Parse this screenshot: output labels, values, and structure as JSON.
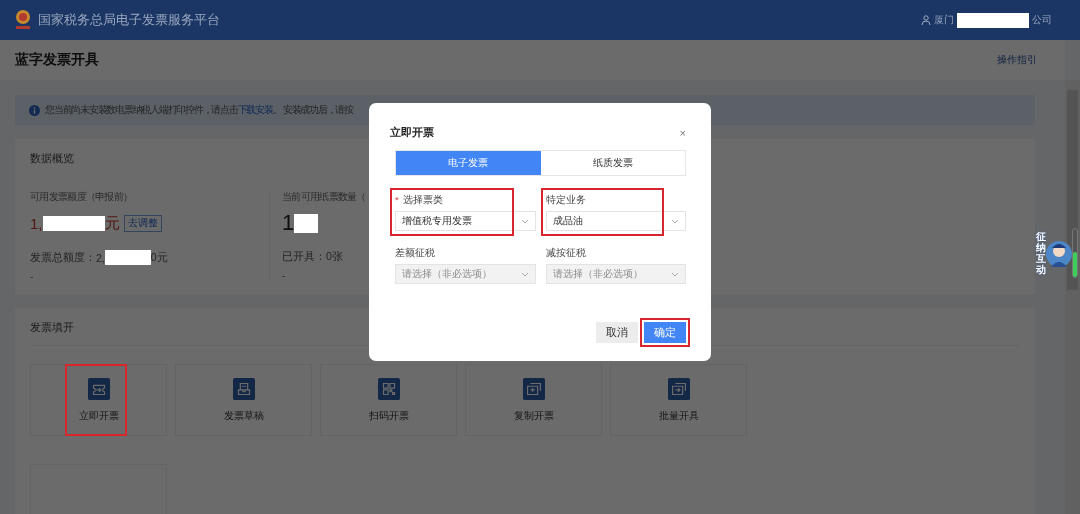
{
  "header": {
    "title": "国家税务总局电子发票服务平台",
    "user_prefix": "厦门",
    "user_suffix": "公司"
  },
  "page": {
    "title": "蓝字发票开具",
    "guide_link": "操作指引"
  },
  "notice": {
    "text_before": "您当前尚未安装数电票纳税人端打印控件，请点击",
    "link": "下载安装",
    "text_after": "。 安装成功后，请按"
  },
  "overview": {
    "title": "数据概览",
    "stats": [
      {
        "kind": "amount",
        "label": "可用发票额度（申报前）",
        "value_prefix": "1,",
        "value_suffix": "元",
        "tag": "去调整",
        "note_label": "发票总额度：",
        "note_prefix": "2,",
        "note_suffix": "0元",
        "footer": "-"
      },
      {
        "kind": "count",
        "label": "当前可用纸票数量（",
        "value_prefix": "1",
        "note_label": "已开具：",
        "note_suffix": "0张",
        "footer": "-"
      }
    ]
  },
  "issue": {
    "title": "发票填开",
    "tiles": [
      {
        "kind": "issue",
        "label": "立即开票",
        "highlighted": true
      },
      {
        "kind": "draft",
        "label": "发票草稿",
        "highlighted": false
      },
      {
        "kind": "scan",
        "label": "扫码开票",
        "highlighted": false
      },
      {
        "kind": "copy",
        "label": "复制开票",
        "highlighted": false
      },
      {
        "kind": "batch",
        "label": "批量开具",
        "highlighted": false
      }
    ]
  },
  "dialog": {
    "title": "立即开票",
    "close": "×",
    "tabs": [
      {
        "label": "电子发票",
        "selected": true
      },
      {
        "label": "纸质发票",
        "selected": false
      }
    ],
    "fields": [
      {
        "label": "选择票类",
        "required_mark": "*",
        "value": "增值税专用发票",
        "disabled": false,
        "highlighted": true
      },
      {
        "label": "特定业务",
        "value": "成品油",
        "disabled": false,
        "highlighted": true
      },
      {
        "label": "差额征税",
        "placeholder": "请选择（非必选项）",
        "disabled": true,
        "highlighted": false
      },
      {
        "label": "减按征税",
        "placeholder": "请选择（非必选项）",
        "disabled": true,
        "highlighted": false
      }
    ],
    "buttons": [
      {
        "label": "取消",
        "kind": "secondary",
        "highlighted": false
      },
      {
        "label": "确定",
        "kind": "primary",
        "highlighted": true
      }
    ]
  },
  "widget": {
    "label": "征纳互动"
  }
}
